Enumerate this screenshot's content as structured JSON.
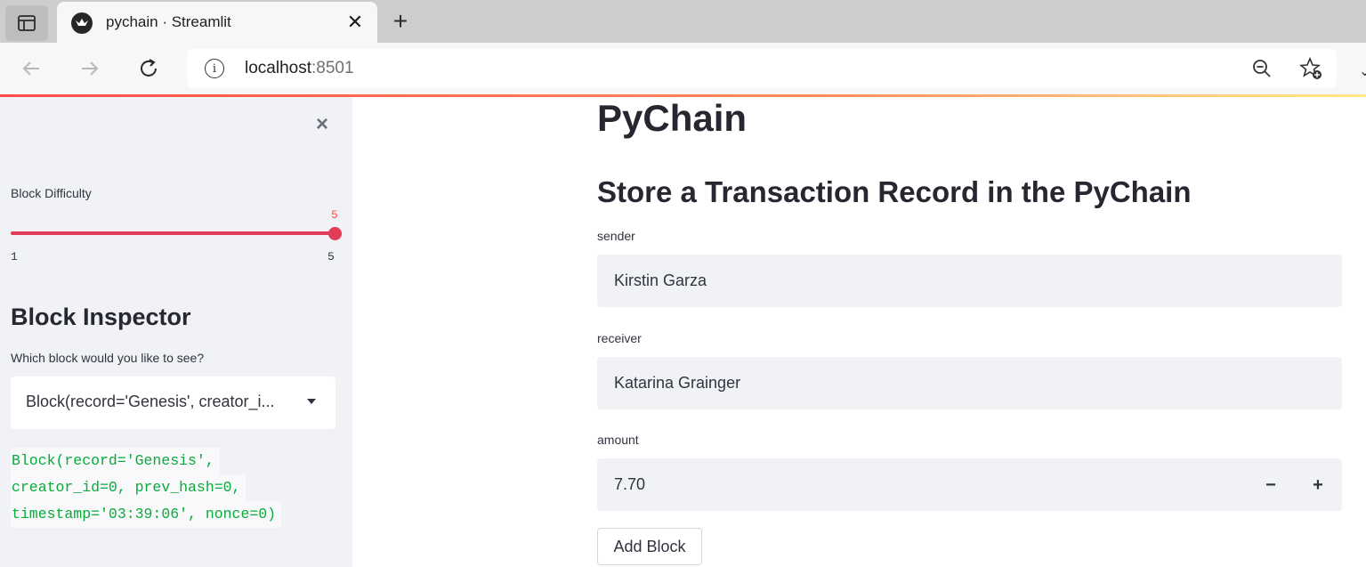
{
  "browser": {
    "tab_title": "pychain · Streamlit",
    "url_host": "localhost",
    "url_port": ":8501"
  },
  "sidebar": {
    "slider": {
      "label": "Block Difficulty",
      "value": "5",
      "min": "1",
      "max": "5",
      "fill_fraction": 1.0
    },
    "inspector_title": "Block Inspector",
    "select_label": "Which block would you like to see?",
    "select_value": "Block(record='Genesis', creator_i...",
    "code_lines": [
      "Block(record='Genesis',",
      "creator_id=0, prev_hash=0,",
      "timestamp='03:39:06', nonce=0)"
    ]
  },
  "main": {
    "title": "PyChain",
    "subtitle": "Store a Transaction Record in the PyChain",
    "sender_label": "sender",
    "sender_value": "Kirstin Garza",
    "receiver_label": "receiver",
    "receiver_value": "Katarina Grainger",
    "amount_label": "amount",
    "amount_value": "7.70",
    "minus_label": "−",
    "plus_label": "+",
    "button_label": "Add Block"
  },
  "colors": {
    "accent": "#ff4b4b",
    "slider": "#e23d58",
    "code": "#09ab3b",
    "sidebar_bg": "#f0f2f6"
  }
}
